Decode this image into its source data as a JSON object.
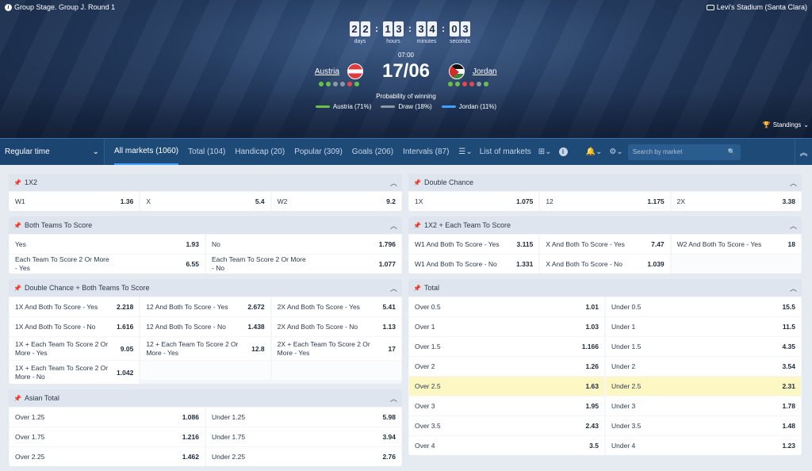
{
  "header": {
    "round": "Group Stage. Group J. Round 1",
    "stadium": "Levi's Stadium (Santa Clara)",
    "countdown": [
      {
        "digits": [
          "2",
          "2"
        ],
        "label": "days"
      },
      {
        "digits": [
          "1",
          "3"
        ],
        "label": "hours"
      },
      {
        "digits": [
          "3",
          "4"
        ],
        "label": "minutes"
      },
      {
        "digits": [
          "0",
          "3"
        ],
        "label": "seconds"
      }
    ],
    "kickoff": "07:00",
    "date": "17/06",
    "home": "Austria",
    "away": "Jordan",
    "home_form": [
      "g",
      "g",
      "n",
      "n",
      "r",
      "g"
    ],
    "away_form": [
      "g",
      "g",
      "r",
      "r",
      "n",
      "g"
    ],
    "prob_title": "Probability of winning",
    "legend": [
      {
        "label": "Austria (71%)",
        "color": "#6cc04a"
      },
      {
        "label": "Draw (18%)",
        "color": "#8e99a8"
      },
      {
        "label": "Jordan (11%)",
        "color": "#3fa0ff"
      }
    ],
    "standings": "Standings"
  },
  "nav": {
    "regular_time": "Regular time",
    "tabs": [
      "All markets (1060)",
      "Total (104)",
      "Handicap (20)",
      "Popular (309)",
      "Goals (206)",
      "Intervals (87)"
    ],
    "list_of_markets": "List of markets",
    "search_placeholder": "Search by market"
  },
  "left": [
    {
      "title": "1X2",
      "rows": [
        [
          [
            "W1",
            "1.36"
          ],
          [
            "X",
            "5.4"
          ],
          [
            "W2",
            "9.2"
          ]
        ]
      ]
    },
    {
      "title": "Both Teams To Score",
      "rows": [
        [
          [
            "Yes",
            "1.93"
          ],
          [
            "No",
            "1.796"
          ]
        ],
        [
          [
            "Each Team To Score 2 Or More - Yes",
            "6.55"
          ],
          [
            "Each Team To Score 2 Or More - No",
            "1.077"
          ]
        ]
      ]
    },
    {
      "title": "Double Chance + Both Teams To Score",
      "rows": [
        [
          [
            "1X And Both To Score - Yes",
            "2.218"
          ],
          [
            "12 And Both To Score - Yes",
            "2.672"
          ],
          [
            "2X And Both To Score - Yes",
            "5.41"
          ]
        ],
        [
          [
            "1X And Both To Score - No",
            "1.616"
          ],
          [
            "12 And Both To Score - No",
            "1.438"
          ],
          [
            "2X And Both To Score - No",
            "1.13"
          ]
        ],
        [
          [
            "1X + Each Team To Score 2 Or More - Yes",
            "9.05"
          ],
          [
            "12 + Each Team To Score 2 Or More - Yes",
            "12.8"
          ],
          [
            "2X + Each Team To Score 2 Or More - Yes",
            "17"
          ]
        ],
        [
          [
            "1X + Each Team To Score 2 Or More - No",
            "1.042"
          ],
          [
            "",
            ""
          ],
          [
            "",
            ""
          ]
        ]
      ]
    },
    {
      "title": "Asian Total",
      "rows": [
        [
          [
            "Over 1.25",
            "1.086"
          ],
          [
            "Under 1.25",
            "5.98"
          ]
        ],
        [
          [
            "Over 1.75",
            "1.216"
          ],
          [
            "Under 1.75",
            "3.94"
          ]
        ],
        [
          [
            "Over 2.25",
            "1.462"
          ],
          [
            "Under 2.25",
            "2.76"
          ]
        ]
      ]
    }
  ],
  "right": [
    {
      "title": "Double Chance",
      "rows": [
        [
          [
            "1X",
            "1.075"
          ],
          [
            "12",
            "1.175"
          ],
          [
            "2X",
            "3.38"
          ]
        ]
      ]
    },
    {
      "title": "1X2 + Each Team To Score",
      "rows": [
        [
          [
            "W1 And Both To Score - Yes",
            "3.115"
          ],
          [
            "X And Both To Score - Yes",
            "7.47"
          ],
          [
            "W2 And Both To Score - Yes",
            "18"
          ]
        ],
        [
          [
            "W1 And Both To Score - No",
            "1.331"
          ],
          [
            "X And Both To Score - No",
            "1.039"
          ],
          [
            "",
            ""
          ]
        ]
      ]
    },
    {
      "title": "Total",
      "rows": [
        [
          [
            "Over 0.5",
            "1.01"
          ],
          [
            "Under 0.5",
            "15.5"
          ]
        ],
        [
          [
            "Over 1",
            "1.03"
          ],
          [
            "Under 1",
            "11.5"
          ]
        ],
        [
          [
            "Over 1.5",
            "1.166"
          ],
          [
            "Under 1.5",
            "4.35"
          ]
        ],
        [
          [
            "Over 2",
            "1.26"
          ],
          [
            "Under 2",
            "3.54"
          ]
        ],
        [
          [
            "Over 2.5",
            "1.63"
          ],
          [
            "Under 2.5",
            "2.31"
          ]
        ],
        [
          [
            "Over 3",
            "1.95"
          ],
          [
            "Under 3",
            "1.78"
          ]
        ],
        [
          [
            "Over 3.5",
            "2.43"
          ],
          [
            "Under 3.5",
            "1.48"
          ]
        ],
        [
          [
            "Over 4",
            "3.5"
          ],
          [
            "Under 4",
            "1.23"
          ]
        ]
      ],
      "highlight_row": 4
    }
  ]
}
